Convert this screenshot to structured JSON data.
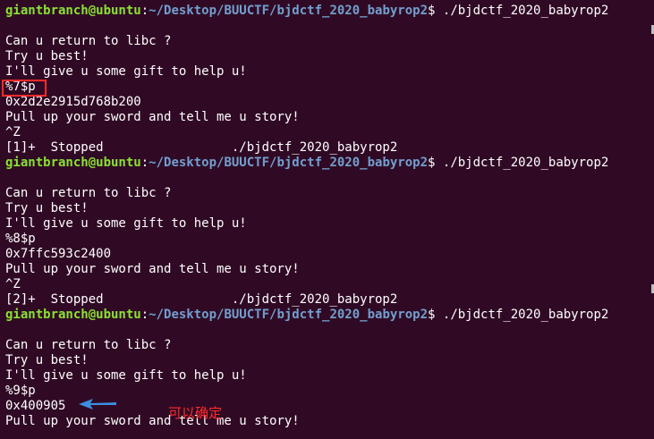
{
  "prompt": {
    "user_host": "giantbranch@ubuntu",
    "sep": ":",
    "path": "~/Desktop/BUUCTF/bjdctf_2020_babyrop2",
    "sym": "$",
    "command": " ./bjdctf_2020_babyrop2"
  },
  "lines": [
    "",
    "",
    "Can u return to libc ?",
    "Try u best!",
    "I'll give u some gift to help u!",
    "%7$p",
    "0x2d2e2915d768b200",
    "Pull up your sword and tell me u story!",
    "^Z",
    "[1]+  Stopped                 ./bjdctf_2020_babyrop2",
    "",
    "",
    "Can u return to libc ?",
    "Try u best!",
    "I'll give u some gift to help u!",
    "%8$p",
    "0x7ffc593c2400",
    "Pull up your sword and tell me u story!",
    "^Z",
    "[2]+  Stopped                 ./bjdctf_2020_babyrop2",
    "",
    "",
    "Can u return to libc ?",
    "Try u best!",
    "I'll give u some gift to help u!",
    "%9$p",
    "0x400905",
    "Pull up your sword and tell me u story!"
  ],
  "annotation": {
    "text": "可以确定",
    "color": "#ff2a2a",
    "arrow_color": "#3b8fe0"
  },
  "colors": {
    "background": "#300a24",
    "prompt_user": "#8ae234",
    "prompt_path": "#729fcf",
    "text": "#ffffff"
  }
}
